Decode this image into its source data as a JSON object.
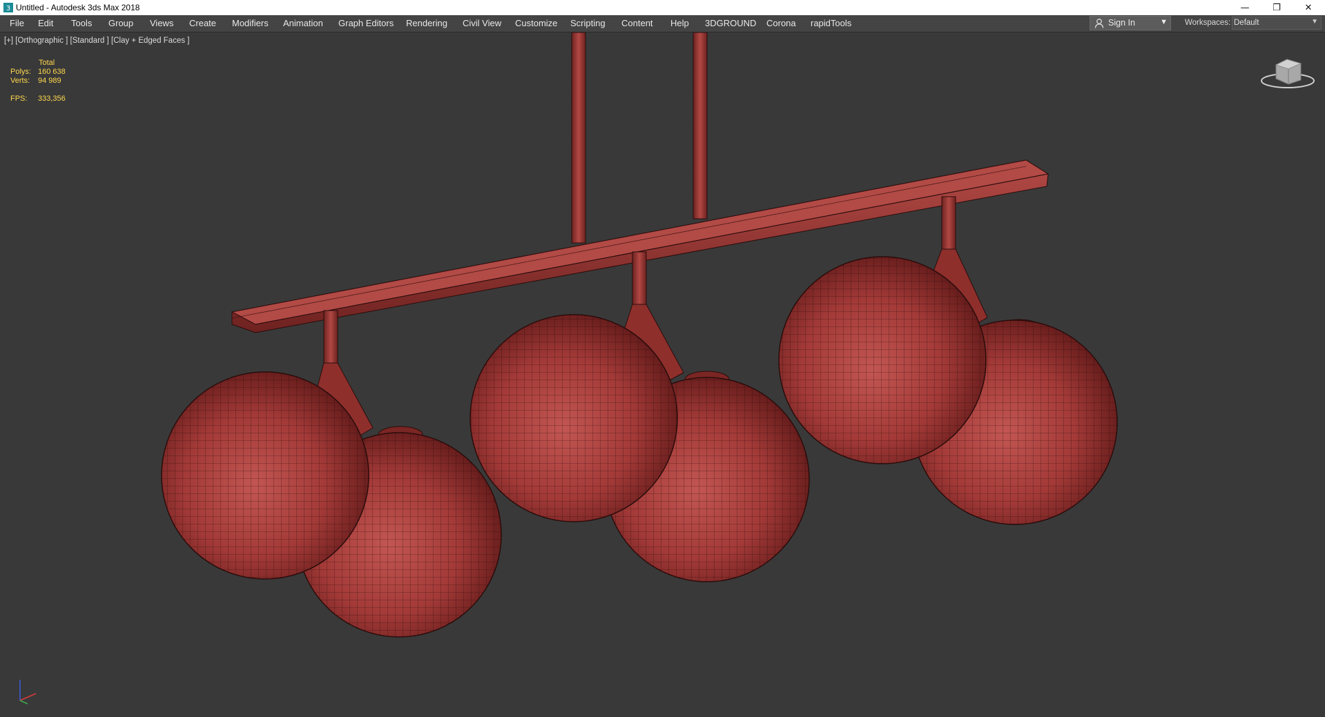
{
  "window": {
    "title": "Untitled - Autodesk 3ds Max 2018",
    "minimize_glyph": "—",
    "restore_glyph": "❐",
    "close_glyph": "✕"
  },
  "menubar": {
    "items": [
      "File",
      "Edit",
      "Tools",
      "Group",
      "Views",
      "Create",
      "Modifiers",
      "Animation",
      "Graph Editors",
      "Rendering",
      "Civil View",
      "Customize",
      "Scripting",
      "Content",
      "Help",
      "3DGROUND",
      "Corona",
      "rapidTools"
    ],
    "sign_in": "Sign In",
    "workspaces_label": "Workspaces:",
    "workspace_value": "Default"
  },
  "viewport": {
    "label": "[+] [Orthographic ] [Standard ] [Clay + Edged Faces ]",
    "stats": {
      "total_label": "Total",
      "polys_label": "Polys:",
      "polys_value": "160 638",
      "verts_label": "Verts:",
      "verts_value": "94 989",
      "fps_label": "FPS:",
      "fps_value": "333,356"
    }
  },
  "colors": {
    "menubar_bg": "#444444",
    "viewport_bg": "#393939",
    "model_red": "#a33a38",
    "stats_yellow": "#ffd84d"
  },
  "icons": {
    "app": "3dsmax-app-icon",
    "user": "user-icon",
    "viewcube": "viewcube-icon",
    "axis": "axis-tripod-icon"
  }
}
